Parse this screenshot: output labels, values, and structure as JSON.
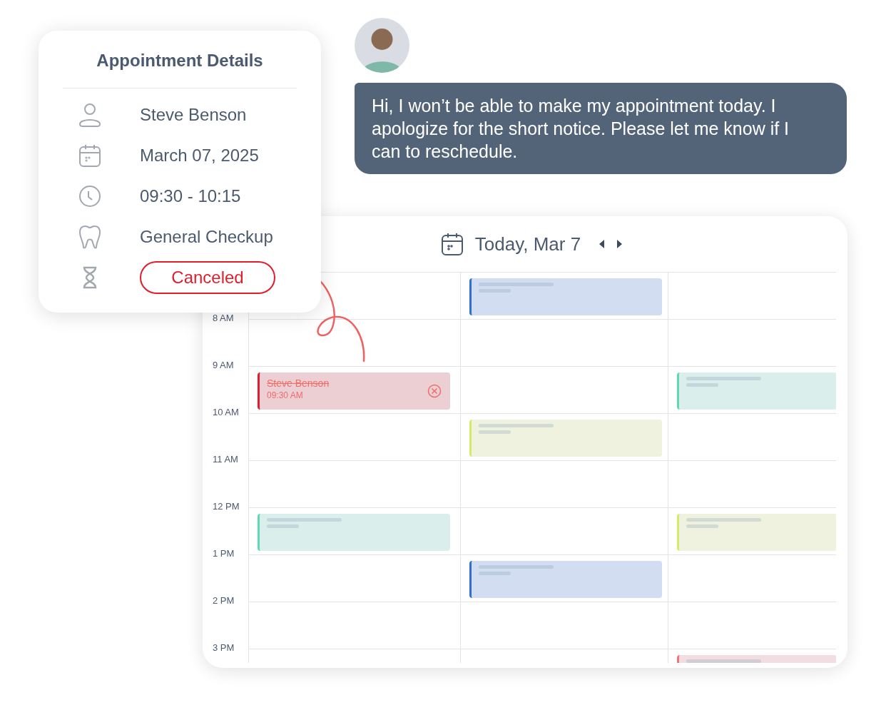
{
  "details_card": {
    "title": "Appointment Details",
    "rows": [
      {
        "kind": "person",
        "value": "Steve Benson"
      },
      {
        "kind": "date",
        "value": "March 07, 2025"
      },
      {
        "kind": "time",
        "value": "09:30 - 10:15"
      },
      {
        "kind": "service",
        "value": "General Checkup"
      },
      {
        "kind": "status",
        "value": "Canceled"
      }
    ]
  },
  "message": {
    "text": "Hi, I won’t be able to make my appointment today. I apologize for the short notice. Please let me know if I can to reschedule."
  },
  "calendar": {
    "title": "Today, Mar 7",
    "rows": [
      {
        "cells": [
          null,
          {
            "kind": "placeholder",
            "color": "#2f6fd8"
          },
          null
        ]
      },
      {
        "label": "8 AM",
        "cells": [
          null,
          null,
          null
        ]
      },
      {
        "label": "9 AM",
        "cells": [
          {
            "kind": "appointment",
            "name": "Steve Benson",
            "time": "09:30 AM",
            "canceled": true,
            "color": "#e01e2b"
          },
          null,
          {
            "kind": "placeholder",
            "color": "#5fd9b5"
          }
        ]
      },
      {
        "label": "10 AM",
        "cells": [
          null,
          {
            "kind": "placeholder",
            "color": "#d6ea6a"
          },
          null
        ]
      },
      {
        "label": "11 AM",
        "cells": [
          null,
          null,
          null
        ]
      },
      {
        "label": "12 PM",
        "cells": [
          {
            "kind": "placeholder",
            "color": "#5fd9b5"
          },
          null,
          {
            "kind": "placeholder",
            "color": "#d6ea6a"
          }
        ]
      },
      {
        "label": "1 PM",
        "cells": [
          null,
          {
            "kind": "placeholder",
            "color": "#2f6fd8"
          },
          null
        ]
      },
      {
        "label": "2 PM",
        "cells": [
          null,
          null,
          null
        ]
      },
      {
        "label": "3 PM",
        "cells": [
          null,
          null,
          {
            "kind": "placeholder",
            "color": "#f07575"
          }
        ]
      }
    ]
  }
}
